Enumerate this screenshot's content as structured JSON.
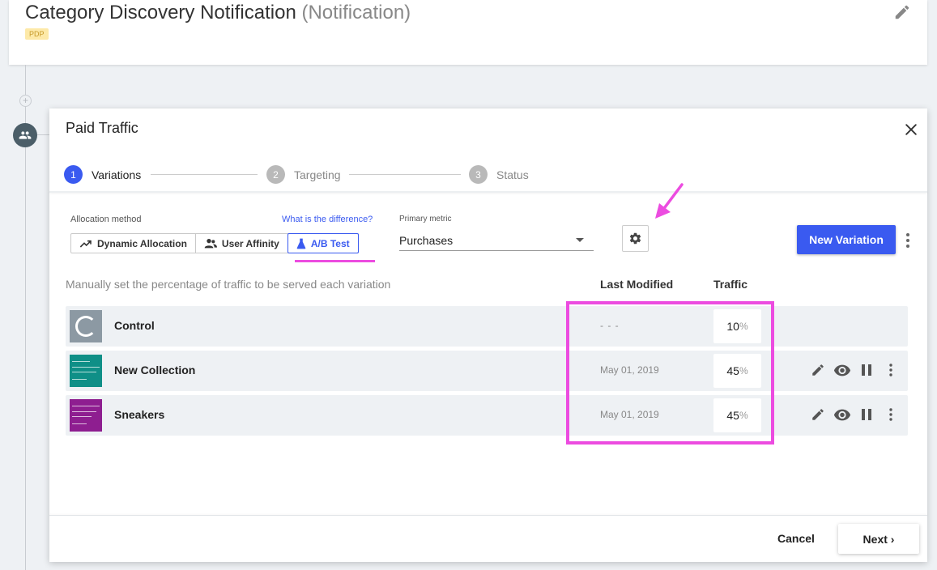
{
  "campaign": {
    "title": "Category Discovery Notification",
    "subtitle": "(Notification)",
    "badge": "PDP",
    "edit_icon": "pencil-icon"
  },
  "timeline": {
    "add_icon": "plus-icon",
    "node_icon": "people-icon"
  },
  "modal": {
    "title": "Paid Traffic",
    "close_icon": "close-icon",
    "steps": [
      {
        "num": "1",
        "label": "Variations",
        "state": "active"
      },
      {
        "num": "2",
        "label": "Targeting",
        "state": "inactive"
      },
      {
        "num": "3",
        "label": "Status",
        "state": "inactive"
      }
    ],
    "allocation": {
      "label": "Allocation method",
      "help_link": "What is the difference?",
      "options": [
        {
          "label": "Dynamic Allocation",
          "icon": "trending-up-icon",
          "selected": false
        },
        {
          "label": "User Affinity",
          "icon": "users-icon",
          "selected": false
        },
        {
          "label": "A/B Test",
          "icon": "flask-icon",
          "selected": true
        }
      ]
    },
    "primary_metric": {
      "label": "Primary metric",
      "value": "Purchases"
    },
    "settings_icon": "gear-icon",
    "new_variation_label": "New Variation",
    "more_icon": "more-vertical-icon",
    "helper_text": "Manually set the percentage of traffic to be served each variation",
    "columns": {
      "last_modified": "Last Modified",
      "traffic": "Traffic"
    },
    "variations": [
      {
        "name": "Control",
        "last_modified": "- - -",
        "traffic": "10",
        "unit": "%",
        "thumb": "control",
        "actions": false
      },
      {
        "name": "New Collection",
        "last_modified": "May 01, 2019",
        "traffic": "45",
        "unit": "%",
        "thumb": "teal",
        "actions": true
      },
      {
        "name": "Sneakers",
        "last_modified": "May 01, 2019",
        "traffic": "45",
        "unit": "%",
        "thumb": "purple",
        "actions": true
      }
    ],
    "row_action_icons": [
      "pencil-icon",
      "eye-icon",
      "pause-icon",
      "more-vertical-icon"
    ],
    "footer": {
      "cancel_label": "Cancel",
      "next_label": "Next ›"
    }
  },
  "colors": {
    "accent": "#3a5af0",
    "annotation": "#ec4ce0",
    "background": "#eef1f4",
    "teal_thumb": "#0f8f87",
    "purple_thumb": "#8e1e90"
  }
}
